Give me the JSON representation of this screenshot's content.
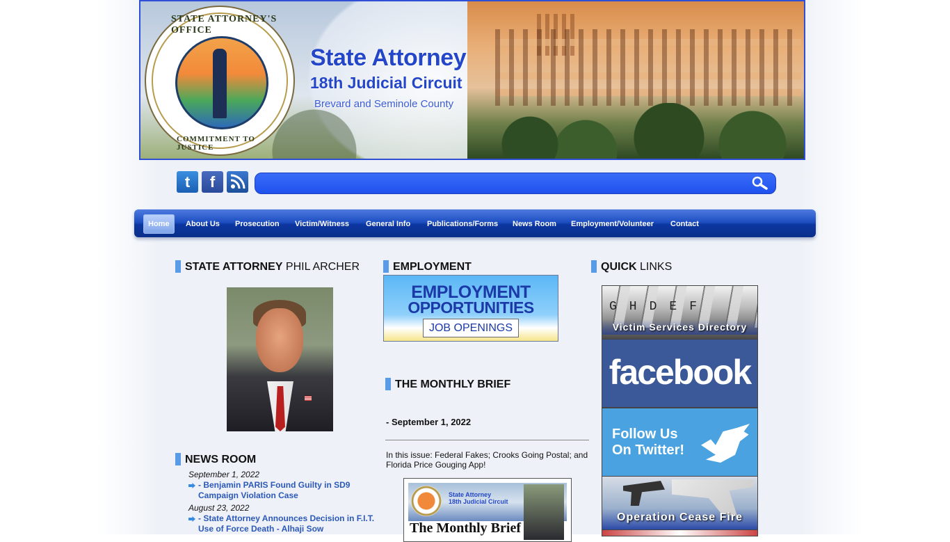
{
  "banner": {
    "title": "State Attorney",
    "subtitle": "18th Judicial Circuit",
    "region": "Brevard and Seminole County",
    "seal_top": "STATE ATTORNEY'S OFFICE",
    "seal_bottom": "COMMITMENT TO JUSTICE"
  },
  "social": {
    "twitter": "t",
    "facebook": "f",
    "rss": "rss"
  },
  "search": {
    "value": "",
    "placeholder": ""
  },
  "nav": {
    "items": [
      "Home",
      "About Us",
      "Prosecution",
      "Victim/Witness",
      "General Info",
      "Publications/Forms",
      "News Room",
      "Employment/Volunteer",
      "Contact"
    ],
    "active": "Home"
  },
  "state_attorney": {
    "heading_bold": "STATE ATTORNEY",
    "heading_light": "PHIL ARCHER"
  },
  "news_room": {
    "heading": "NEWS ROOM",
    "entries": [
      {
        "date": "September 1, 2022",
        "title": "- Benjamin PARIS Found Guilty in SD9 Campaign Violation Case"
      },
      {
        "date": "August 23, 2022",
        "title": "- State Attorney Announces Decision in F.I.T. Use of Force Death - Alhaji Sow"
      }
    ]
  },
  "employment": {
    "heading": "EMPLOYMENT",
    "banner_line1": "EMPLOYMENT",
    "banner_line2": "OPPORTUNITIES",
    "banner_button": "JOB OPENINGS"
  },
  "monthly_brief": {
    "heading": "THE MONTHLY BRIEF",
    "date": "- September 1, 2022",
    "summary": "In this issue: Federal Fakes; Crooks Going Postal; and Florida Price Gouging App!",
    "thumb_title_1": "State Attorney",
    "thumb_title_2": "18th Judicial Circuit",
    "thumb_caption": "The Monthly Brief"
  },
  "quick_links": {
    "heading_bold": "QUICK",
    "heading_light": "LINKS",
    "victim_letters": "GHDEF",
    "victim_services": "Victim Services Directory",
    "facebook": "facebook",
    "twitter_line1": "Follow Us",
    "twitter_line2": "On Twitter!",
    "cease_fire": "Operation Cease Fire"
  },
  "colors": {
    "brand_blue": "#2446c8",
    "nav_blue": "#1e4fc2",
    "heading_bar": "#5a9be8",
    "link": "#2c58b8"
  }
}
